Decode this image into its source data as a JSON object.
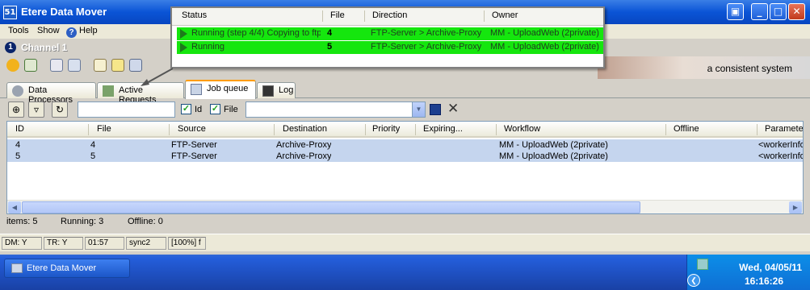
{
  "window": {
    "title": "Etere Data Mover",
    "app_icon": "51"
  },
  "menu": {
    "items": [
      "Tools",
      "Show",
      "Help"
    ]
  },
  "channel": {
    "number": "1",
    "label": "Channel 1"
  },
  "banner": {
    "text": "a consistent system"
  },
  "tabs": [
    {
      "label": "Data Processors",
      "icon": "gear-icon",
      "active": false
    },
    {
      "label": "Active Requests",
      "icon": "pencil-icon",
      "active": false
    },
    {
      "label": "Job queue",
      "icon": "list-icon",
      "active": true
    },
    {
      "label": "Log",
      "icon": "monitor-icon",
      "active": false
    }
  ],
  "filter": {
    "text_value": "",
    "id_checkbox": {
      "label": "Id",
      "checked": true
    },
    "file_checkbox": {
      "label": "File",
      "checked": true
    },
    "combo_value": ""
  },
  "grid": {
    "columns": [
      "ID",
      "File",
      "Source",
      "Destination",
      "Priority",
      "Expiring...",
      "Workflow",
      "Offline",
      "Paramete"
    ],
    "rows": [
      {
        "id": "4",
        "file": "4",
        "source": "FTP-Server",
        "destination": "Archive-Proxy",
        "priority": "",
        "expiring": "",
        "workflow": "MM - UploadWeb (2private)",
        "offline": "",
        "parameters": "<workerInfo"
      },
      {
        "id": "5",
        "file": "5",
        "source": "FTP-Server",
        "destination": "Archive-Proxy",
        "priority": "",
        "expiring": "",
        "workflow": "MM - UploadWeb (2private)",
        "offline": "",
        "parameters": "<workerInfo"
      }
    ]
  },
  "summary": {
    "items": "items: 5",
    "running": "Running: 3",
    "offline": "Offline: 0"
  },
  "statusbar": {
    "dm": "DM: Y",
    "tr": "TR: Y",
    "time": "01:57",
    "sync": "sync2",
    "zoom": "[100%] f"
  },
  "popup": {
    "columns": [
      "Status",
      "File",
      "Direction",
      "Owner"
    ],
    "rows": [
      {
        "status": "Running (step 4/4) Copying to ftp",
        "file": "4",
        "direction": "FTP-Server > Archive-Proxy",
        "owner": "MM - UploadWeb (2private)"
      },
      {
        "status": "Running",
        "file": "5",
        "direction": "FTP-Server > Archive-Proxy",
        "owner": "MM - UploadWeb (2private)"
      }
    ],
    "row_color": "#15e60e"
  },
  "taskbar": {
    "task_label": "Etere Data Mover",
    "date": "Wed, 04/05/11",
    "time": "16:16:26"
  }
}
